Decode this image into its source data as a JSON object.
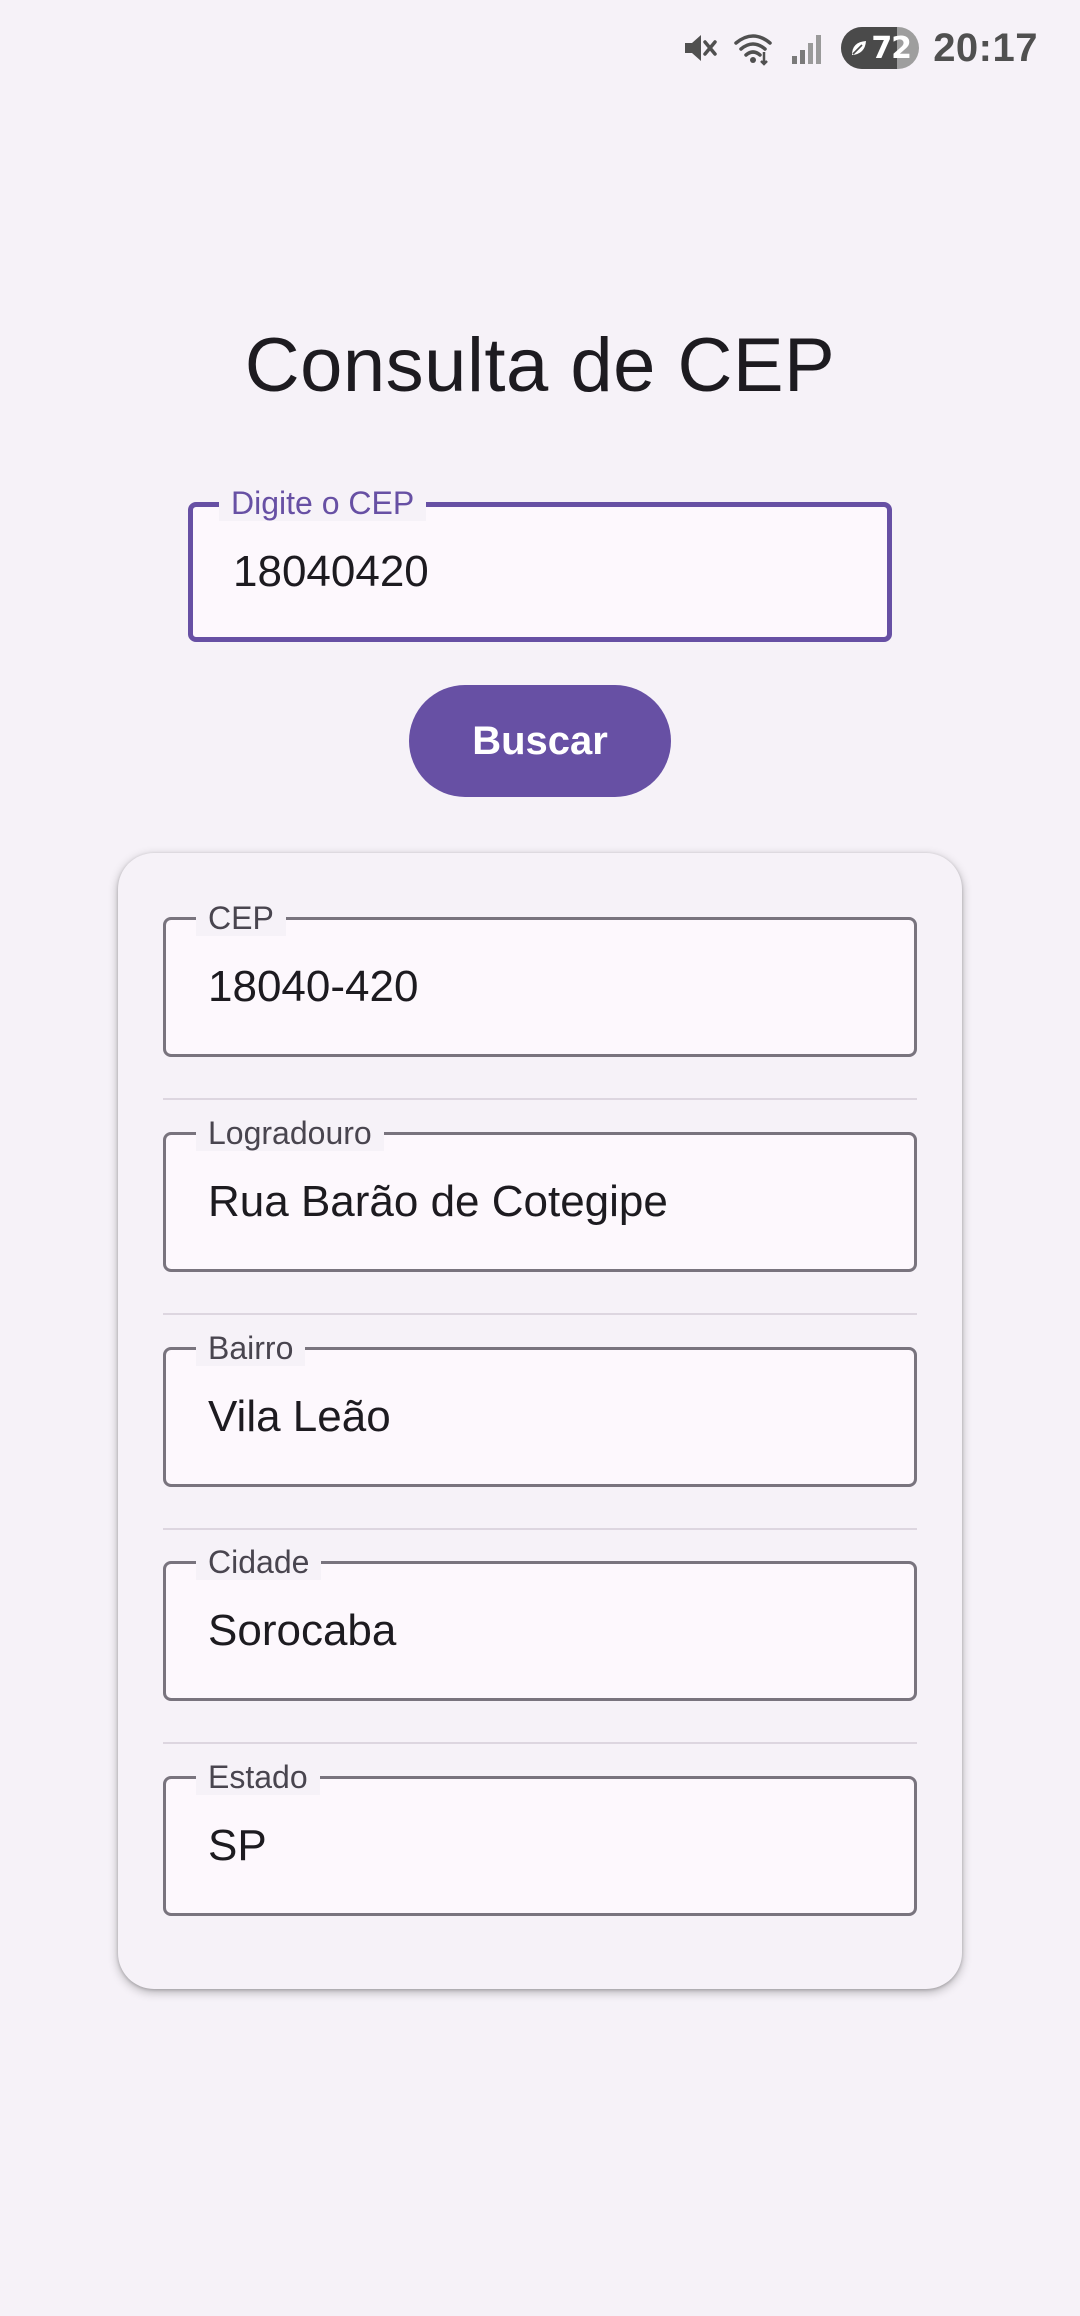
{
  "status_bar": {
    "time": "20:17",
    "battery_level": "72",
    "battery_fraction": 0.72,
    "icons": [
      "mute-icon",
      "wifi-icon",
      "signal-icon",
      "battery-saver-leaf-icon"
    ]
  },
  "page": {
    "title": "Consulta de CEP"
  },
  "search": {
    "label": "Digite o CEP",
    "value": "18040420"
  },
  "search_button": {
    "label": "Buscar"
  },
  "result": {
    "fields": [
      {
        "label": "CEP",
        "value": "18040-420"
      },
      {
        "label": "Logradouro",
        "value": "Rua Barão de Cotegipe"
      },
      {
        "label": "Bairro",
        "value": "Vila Leão"
      },
      {
        "label": "Cidade",
        "value": "Sorocaba"
      },
      {
        "label": "Estado",
        "value": "SP"
      }
    ]
  },
  "colors": {
    "primary": "#6750a4",
    "background": "#f6f2f8",
    "outline": "#79747e",
    "text": "#1d1b20"
  }
}
